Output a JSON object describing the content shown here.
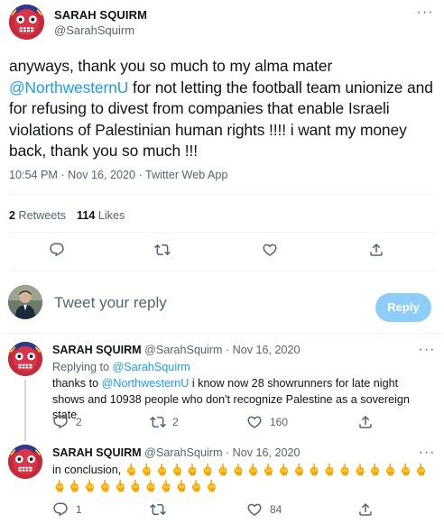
{
  "main_tweet": {
    "name": "SARAH SQUIRM",
    "handle": "@SarahSquirm",
    "text_before": "anyways, thank you so much to my alma mater ",
    "mention": "@NorthwesternU",
    "text_after": " for not letting the football team unionize and for refusing to divest from companies that enable Israeli violations of Palestinian human rights !!!! i want my money back, thank you so much !!!",
    "meta": "10:54 PM · Nov 16, 2020 · Twitter Web App",
    "retweets_count": "2",
    "retweets_label": "Retweets",
    "likes_count": "114",
    "likes_label": "Likes"
  },
  "reply_box": {
    "placeholder": "Tweet your reply",
    "button_label": "Reply"
  },
  "replies": [
    {
      "name": "SARAH SQUIRM",
      "sub": "@SarahSquirm · Nov 16, 2020",
      "replying_prefix": "Replying to ",
      "replying_to": "@SarahSquirm",
      "text_before": "thanks to ",
      "mention": "@NorthwesternU",
      "text_after": " i know now 28 showrunners for late night shows and 10938 people who don't recognize Palestine as a sovereign state",
      "reply_count": "2",
      "retweet_count": "2",
      "like_count": "160"
    },
    {
      "name": "SARAH SQUIRM",
      "sub": "@SarahSquirm · Nov 16, 2020",
      "text": "in conclusion, ",
      "emoji_line1": "🖕🖕🖕🖕🖕🖕🖕🖕🖕🖕🖕🖕🖕🖕🖕🖕🖕🖕🖕🖕",
      "emoji_line2": "🖕🖕🖕🖕🖕🖕🖕🖕🖕🖕🖕",
      "reply_count": "1",
      "retweet_count": "",
      "like_count": "84"
    }
  ],
  "icons": {
    "reply": "reply-icon",
    "retweet": "retweet-icon",
    "like": "heart-icon",
    "share": "share-icon",
    "more": "more-icon"
  },
  "colors": {
    "accent": "#1d9bf0",
    "reply_button": "#8ecdf7",
    "text": "#0f1419",
    "muted": "#536471"
  }
}
